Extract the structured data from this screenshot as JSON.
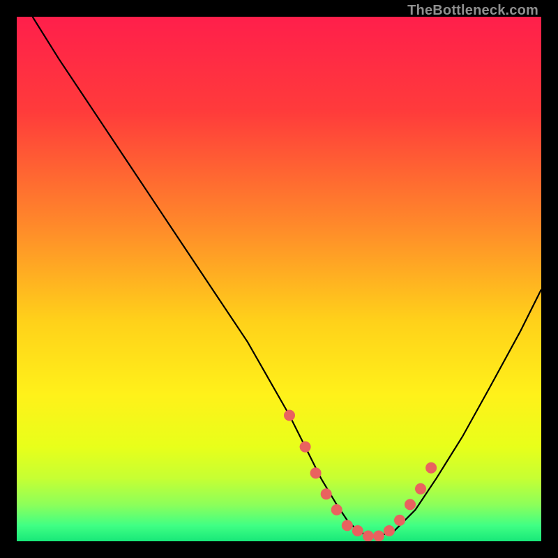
{
  "watermark": "TheBottleneck.com",
  "chart_data": {
    "type": "line",
    "title": "",
    "xlabel": "",
    "ylabel": "",
    "xlim": [
      0,
      100
    ],
    "ylim": [
      0,
      100
    ],
    "series": [
      {
        "name": "bottleneck-curve",
        "x": [
          3,
          8,
          14,
          20,
          26,
          32,
          38,
          44,
          48,
          52,
          55,
          58,
          61,
          63,
          65,
          67,
          69,
          72,
          76,
          80,
          85,
          90,
          96,
          100
        ],
        "y": [
          100,
          92,
          83,
          74,
          65,
          56,
          47,
          38,
          31,
          24,
          18,
          12,
          7,
          4,
          2,
          1,
          1,
          2,
          6,
          12,
          20,
          29,
          40,
          48
        ]
      }
    ],
    "markers": {
      "name": "highlighted-points",
      "x": [
        52,
        55,
        57,
        59,
        61,
        63,
        65,
        67,
        69,
        71,
        73,
        75,
        77,
        79
      ],
      "y": [
        24,
        18,
        13,
        9,
        6,
        3,
        2,
        1,
        1,
        2,
        4,
        7,
        10,
        14
      ]
    },
    "gradient_stops": [
      {
        "offset": 0,
        "color": "#ff1f4b"
      },
      {
        "offset": 18,
        "color": "#ff3b3b"
      },
      {
        "offset": 40,
        "color": "#ff8a2a"
      },
      {
        "offset": 58,
        "color": "#ffd11a"
      },
      {
        "offset": 72,
        "color": "#fff11a"
      },
      {
        "offset": 82,
        "color": "#e8ff1a"
      },
      {
        "offset": 88,
        "color": "#c6ff33"
      },
      {
        "offset": 93,
        "color": "#8dff5a"
      },
      {
        "offset": 97,
        "color": "#40ff84"
      },
      {
        "offset": 100,
        "color": "#18e879"
      }
    ],
    "marker_color": "#e9625f",
    "curve_color": "#000000"
  }
}
